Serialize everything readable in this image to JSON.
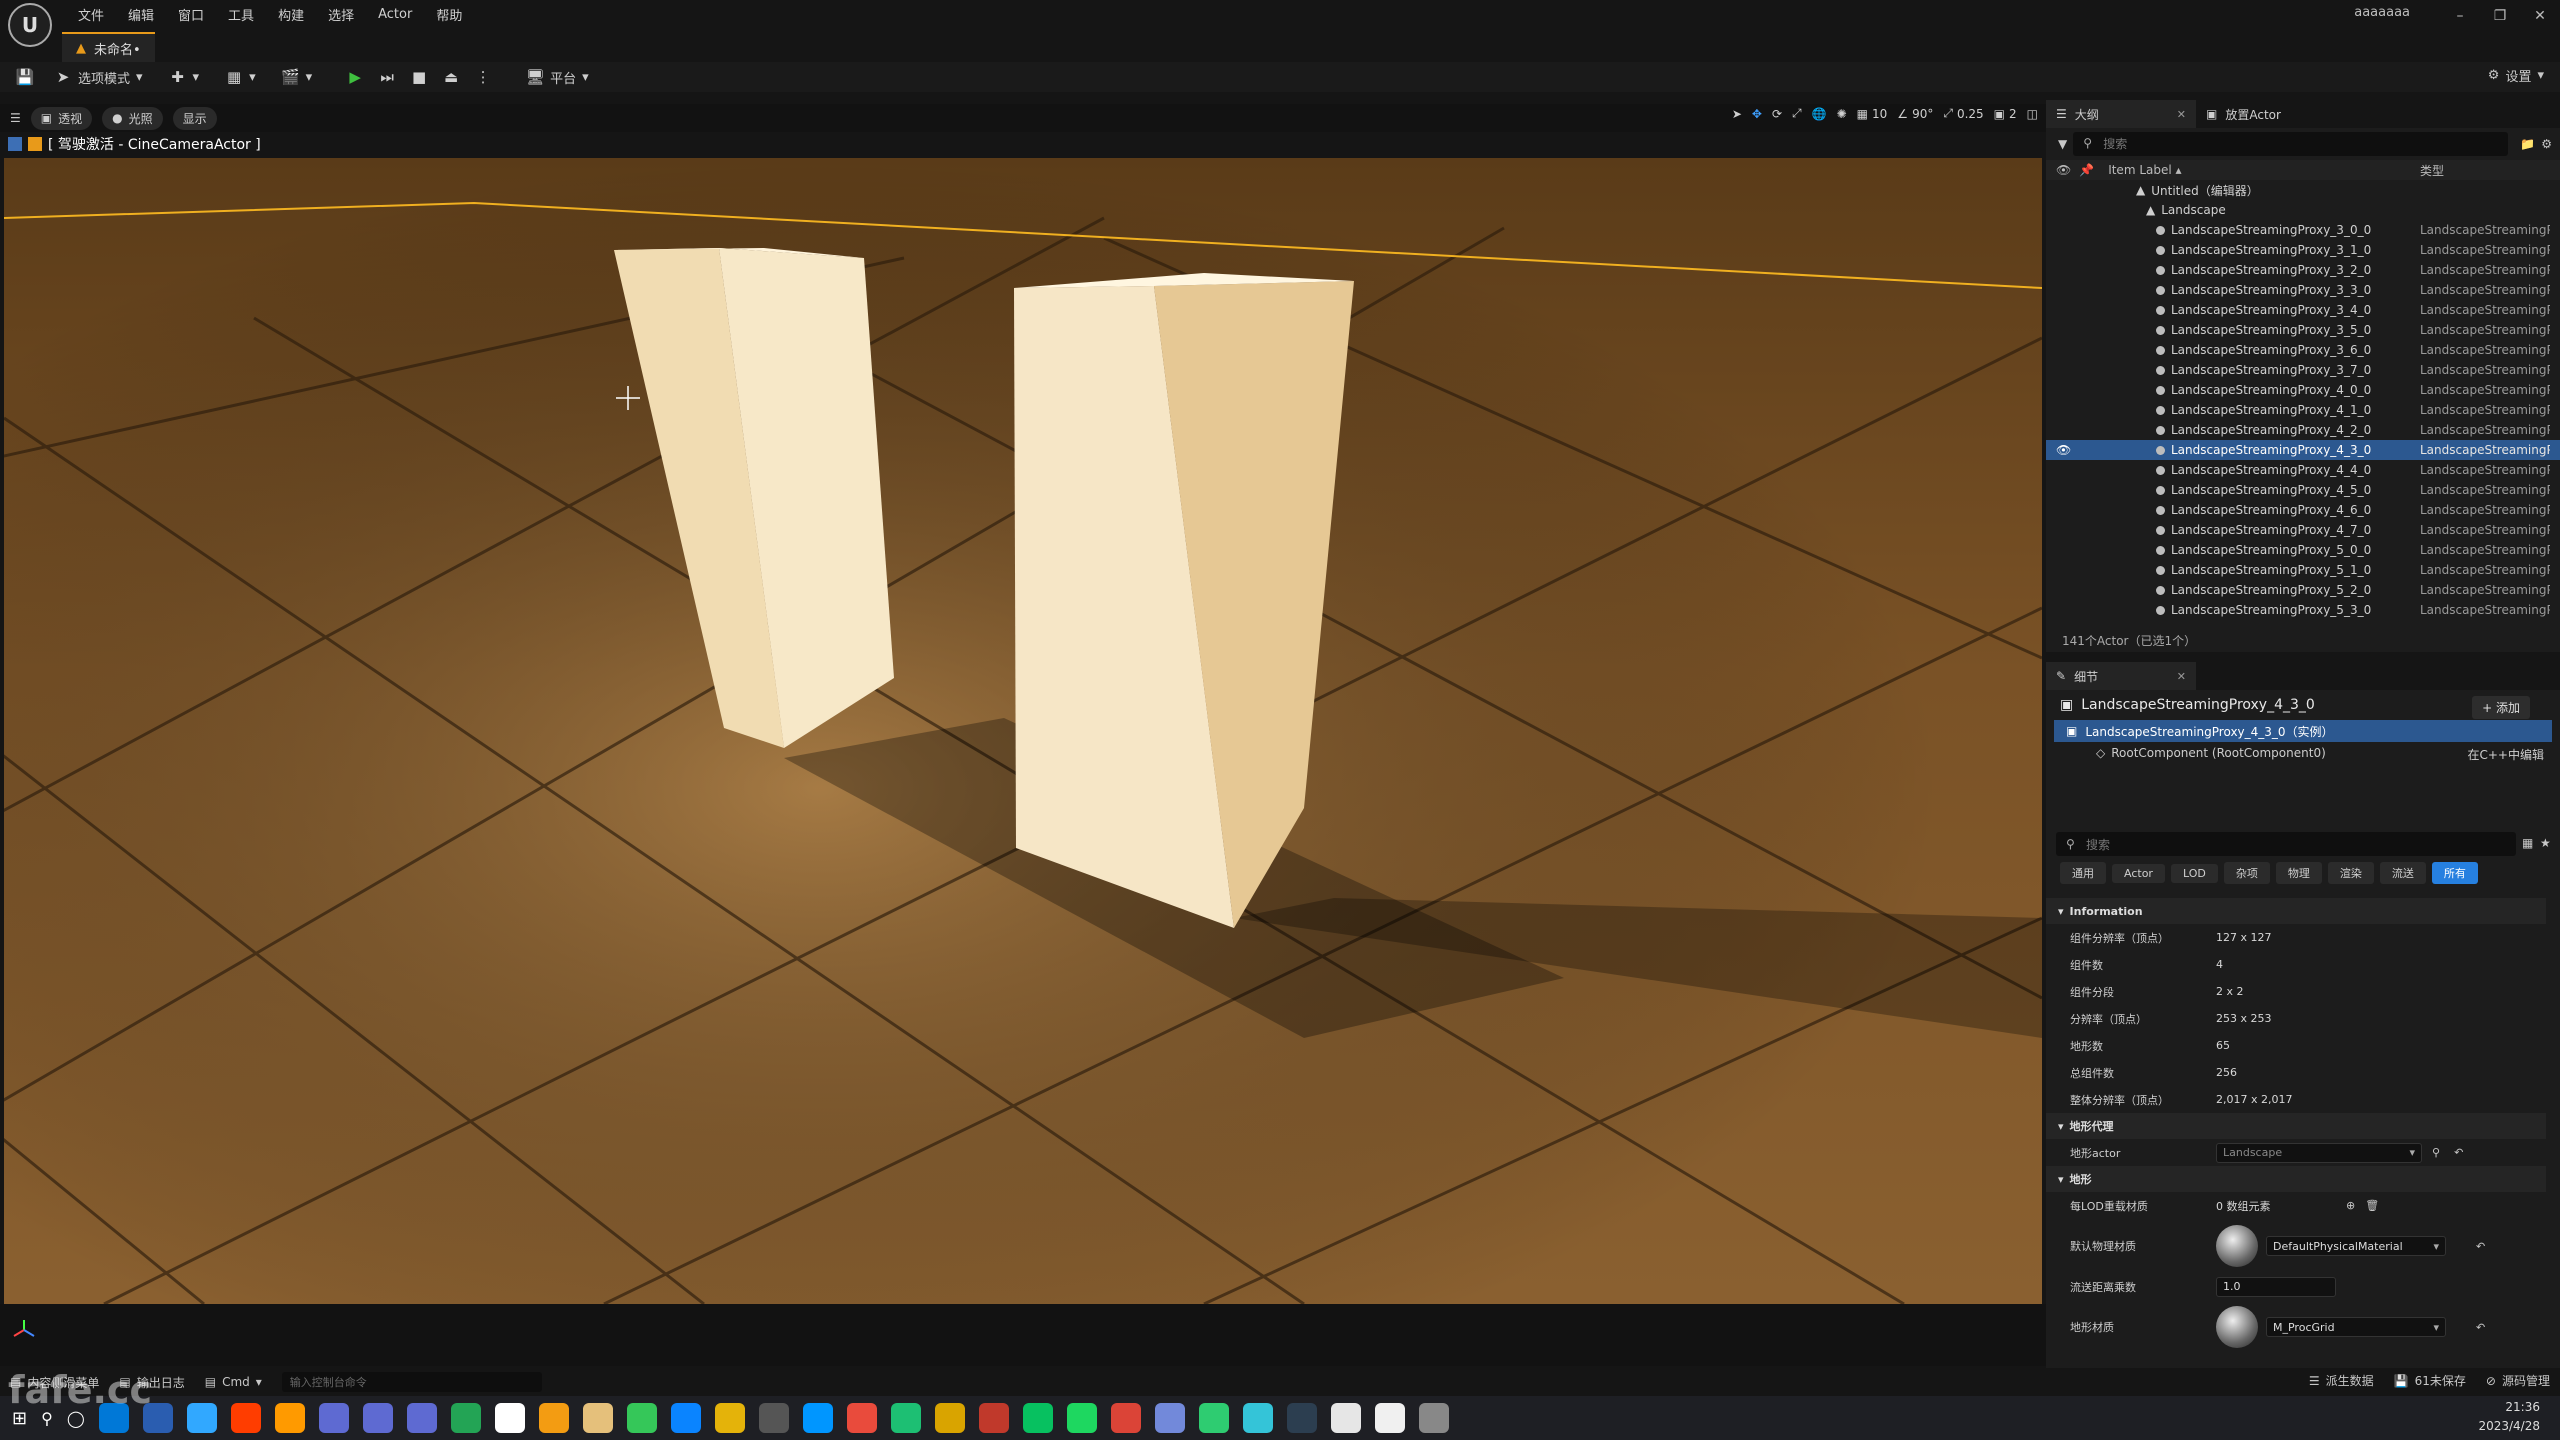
{
  "menu": [
    "文件",
    "编辑",
    "窗口",
    "工具",
    "构建",
    "选择",
    "Actor",
    "帮助"
  ],
  "user": "aaaaaaa",
  "level_tab": "未命名•",
  "toolbar": {
    "mode": "选项模式",
    "platform": "平台",
    "settings": "设置"
  },
  "viewport": {
    "perspective": "透视",
    "lighting": "光照",
    "show": "显示",
    "pilot_label": "[ 驾驶激活 - CineCameraActor ]",
    "grid_snap": "10",
    "rot_snap": "90°",
    "scale_snap": "0.25",
    "cam_speed": "2"
  },
  "outliner": {
    "tab": "大纲",
    "tab2": "放置Actor",
    "search_placeholder": "搜索",
    "col_label": "Item Label ▴",
    "col_type": "类型",
    "root": "Untitled（编辑器）",
    "group": "Landscape",
    "type_text": "LandscapeStreamingProxy",
    "items": [
      "LandscapeStreamingProxy_3_0_0",
      "LandscapeStreamingProxy_3_1_0",
      "LandscapeStreamingProxy_3_2_0",
      "LandscapeStreamingProxy_3_3_0",
      "LandscapeStreamingProxy_3_4_0",
      "LandscapeStreamingProxy_3_5_0",
      "LandscapeStreamingProxy_3_6_0",
      "LandscapeStreamingProxy_3_7_0",
      "LandscapeStreamingProxy_4_0_0",
      "LandscapeStreamingProxy_4_1_0",
      "LandscapeStreamingProxy_4_2_0",
      "LandscapeStreamingProxy_4_3_0",
      "LandscapeStreamingProxy_4_4_0",
      "LandscapeStreamingProxy_4_5_0",
      "LandscapeStreamingProxy_4_6_0",
      "LandscapeStreamingProxy_4_7_0",
      "LandscapeStreamingProxy_5_0_0",
      "LandscapeStreamingProxy_5_1_0",
      "LandscapeStreamingProxy_5_2_0",
      "LandscapeStreamingProxy_5_3_0"
    ],
    "selected_index": 11,
    "count": "141个Actor（已选1个）"
  },
  "details": {
    "tab": "细节",
    "title": "LandscapeStreamingProxy_4_3_0",
    "add": "+ 添加",
    "instance": "LandscapeStreamingProxy_4_3_0（实例）",
    "root_component": "RootComponent (RootComponent0)",
    "edit_cpp": "在C++中编辑",
    "search_placeholder": "搜索",
    "filters": [
      "通用",
      "Actor",
      "LOD",
      "杂项",
      "物理",
      "渲染",
      "流送",
      "所有"
    ],
    "info_header": "Information",
    "info": [
      {
        "name": "组件分辨率（顶点）",
        "value": "127 x 127"
      },
      {
        "name": "组件数",
        "value": "4"
      },
      {
        "name": "组件分段",
        "value": "2 x 2"
      },
      {
        "name": "分辨率（顶点）",
        "value": "253 x 253"
      },
      {
        "name": "地形数",
        "value": "65"
      },
      {
        "name": "总组件数",
        "value": "256"
      },
      {
        "name": "整体分辨率（顶点）",
        "value": "2,017 x 2,017"
      }
    ],
    "proxy_header": "地形代理",
    "landscape_actor_label": "地形actor",
    "landscape_actor_value": "Landscape",
    "landscape_header": "地形",
    "lod_label": "每LOD重载材质",
    "lod_value": "0 数组元素",
    "phys_label": "默认物理材质",
    "phys_value": "DefaultPhysicalMaterial",
    "stream_label": "流送距离乘数",
    "stream_value": "1.0",
    "mat_label": "地形材质",
    "mat_value": "M_ProcGrid"
  },
  "status": {
    "content_drawer": "内容侧滑菜单",
    "output_log": "输出日志",
    "cmd": "Cmd",
    "cmd_placeholder": "输入控制台命令",
    "derived": "派生数据",
    "unsaved": "61未保存",
    "source": "源码管理"
  },
  "clock": {
    "time": "21:36",
    "date": "2023/4/28"
  },
  "watermark": "fafe.cc",
  "taskbar_apps": [
    "#0078d7",
    "#2a5db0",
    "#31a8ff",
    "#ff3d00",
    "#ff9a00",
    "#5e6ad2",
    "#5e6ad2",
    "#5e6ad2",
    "#23a455",
    "#ffffff",
    "#f39c12",
    "#e5c07b",
    "#35c759",
    "#0a84ff",
    "#e4b30a",
    "#555555",
    "#0096ff",
    "#e94b3c",
    "#1dbf73",
    "#d9a400",
    "#c0392b",
    "#07c160",
    "#1ed760",
    "#db4437",
    "#7289da",
    "#2ecc71",
    "#34c4d8",
    "#2c3e50",
    "#e6e6e6",
    "#f0f0f0",
    "#888888"
  ],
  "colors": {
    "accent": "#e89a1a",
    "selection": "#2c5890",
    "play": "#3fbf3f"
  }
}
